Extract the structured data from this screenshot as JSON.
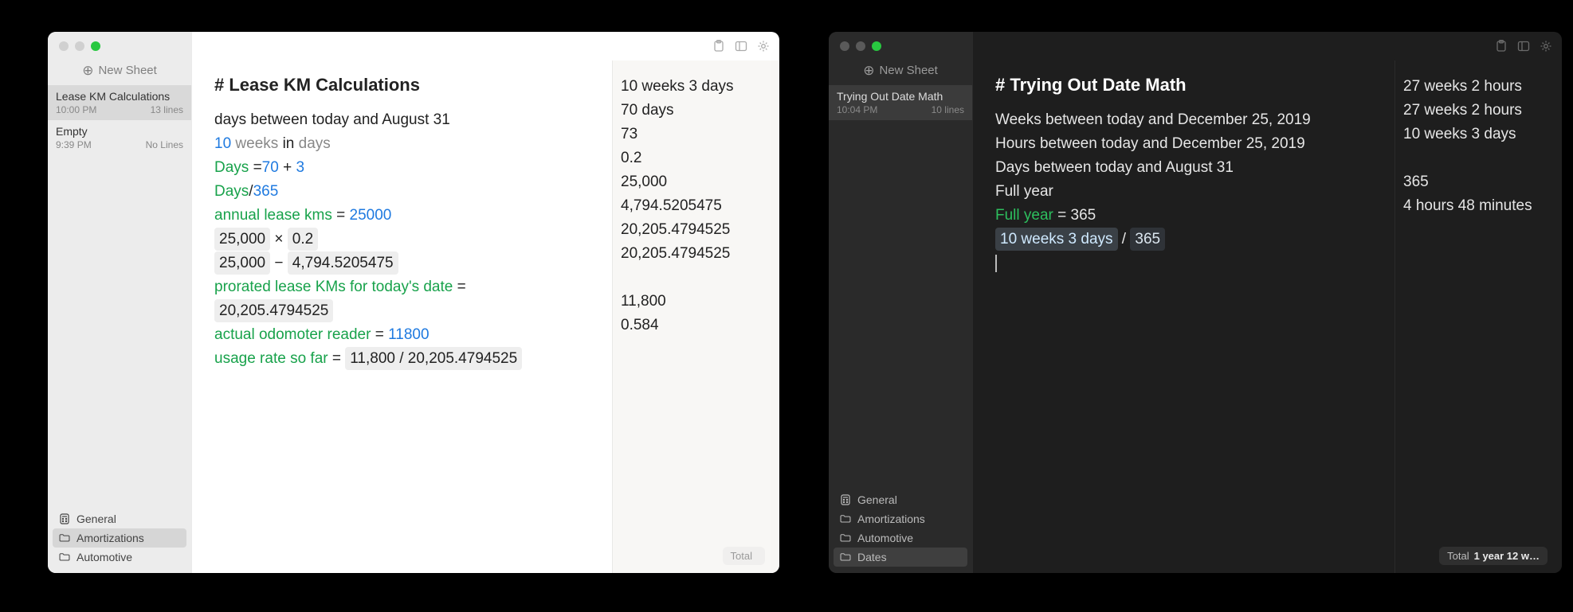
{
  "light": {
    "new_sheet_label": "New Sheet",
    "sheets": [
      {
        "name": "Lease KM Calculations",
        "time": "10:00 PM",
        "meta": "13 lines",
        "selected": true
      },
      {
        "name": "Empty",
        "time": "9:39 PM",
        "meta": "No Lines",
        "selected": false
      }
    ],
    "folders": [
      {
        "name": "General",
        "icon": "calc",
        "selected": false
      },
      {
        "name": "Amortizations",
        "icon": "folder",
        "selected": true
      },
      {
        "name": "Automotive",
        "icon": "folder",
        "selected": false
      }
    ],
    "title": "# Lease KM Calculations",
    "lines": [
      {
        "plain": "days between today and August 31"
      },
      {
        "spans": [
          {
            "t": "10",
            "c": "tok-num"
          },
          {
            "t": " "
          },
          {
            "t": "weeks",
            "c": "tok-unit"
          },
          {
            "t": " "
          },
          {
            "t": "in",
            "c": ""
          },
          {
            "t": " "
          },
          {
            "t": "days",
            "c": "tok-unit"
          }
        ]
      },
      {
        "spans": [
          {
            "t": "Days",
            "c": "tok-var"
          },
          {
            "t": " ="
          },
          {
            "t": "70",
            "c": "tok-num"
          },
          {
            "t": " + "
          },
          {
            "t": "3",
            "c": "tok-num"
          }
        ]
      },
      {
        "spans": [
          {
            "t": "Days",
            "c": "tok-var"
          },
          {
            "t": "/"
          },
          {
            "t": "365",
            "c": "tok-num"
          }
        ]
      },
      {
        "spans": [
          {
            "t": "annual lease kms",
            "c": "tok-var"
          },
          {
            "t": " = "
          },
          {
            "t": "25000",
            "c": "tok-num"
          }
        ]
      },
      {
        "spans": [
          {
            "t": "25,000",
            "c": "tok-chip"
          },
          {
            "t": "  ×  "
          },
          {
            "t": "0.2",
            "c": "tok-chip"
          }
        ]
      },
      {
        "spans": [
          {
            "t": "25,000",
            "c": "tok-chip"
          },
          {
            "t": "  −  "
          },
          {
            "t": "4,794.5205475",
            "c": "tok-chip"
          }
        ]
      },
      {
        "spans": [
          {
            "t": "prorated lease KMs for today's date",
            "c": "tok-var"
          },
          {
            "t": " = "
          }
        ],
        "wrap": {
          "t": "20,205.4794525",
          "c": "tok-chip"
        }
      },
      {
        "spans": [
          {
            "t": "actual odomoter reader",
            "c": "tok-var"
          },
          {
            "t": " = "
          },
          {
            "t": "11800",
            "c": "tok-num"
          }
        ]
      },
      {
        "spans": [
          {
            "t": "usage rate so far",
            "c": "tok-var"
          },
          {
            "t": " =  "
          },
          {
            "t": "11,800 / 20,205.4794525",
            "c": "tok-chip"
          }
        ]
      }
    ],
    "results": [
      "10 weeks 3 days",
      "70 days",
      "73",
      "0.2",
      "25,000",
      "4,794.5205475",
      "20,205.4794525",
      "20,205.4794525",
      "",
      "11,800",
      "0.584"
    ],
    "total_label": "Total",
    "total_value": ""
  },
  "dark": {
    "new_sheet_label": "New Sheet",
    "sheets": [
      {
        "name": "Trying Out Date Math",
        "time": "10:04 PM",
        "meta": "10 lines",
        "selected": true
      }
    ],
    "folders": [
      {
        "name": "General",
        "icon": "calc",
        "selected": false
      },
      {
        "name": "Amortizations",
        "icon": "folder",
        "selected": false
      },
      {
        "name": "Automotive",
        "icon": "folder",
        "selected": false
      },
      {
        "name": "Dates",
        "icon": "folder",
        "selected": true
      }
    ],
    "title": "# Trying Out Date Math",
    "lines": [
      {
        "plain": "Weeks between today and December 25, 2019"
      },
      {
        "plain": "Hours between today and December 25, 2019"
      },
      {
        "plain": "Days between today and August 31"
      },
      {
        "plain": "Full year"
      },
      {
        "spans": [
          {
            "t": "Full year",
            "c": "tok-var"
          },
          {
            "t": " = 365"
          }
        ]
      },
      {
        "spans": [
          {
            "t": "10 weeks 3 days",
            "c": "tok-chip"
          },
          {
            "t": " / "
          },
          {
            "t": "365",
            "c": "tok-chip lite"
          }
        ]
      },
      {
        "cursor": true
      }
    ],
    "results": [
      "27 weeks 2 hours",
      "27 weeks 2 hours",
      "10 weeks 3 days",
      "",
      "365",
      "4 hours 48 minutes"
    ],
    "total_label": "Total",
    "total_value": "1 year 12 w…"
  }
}
